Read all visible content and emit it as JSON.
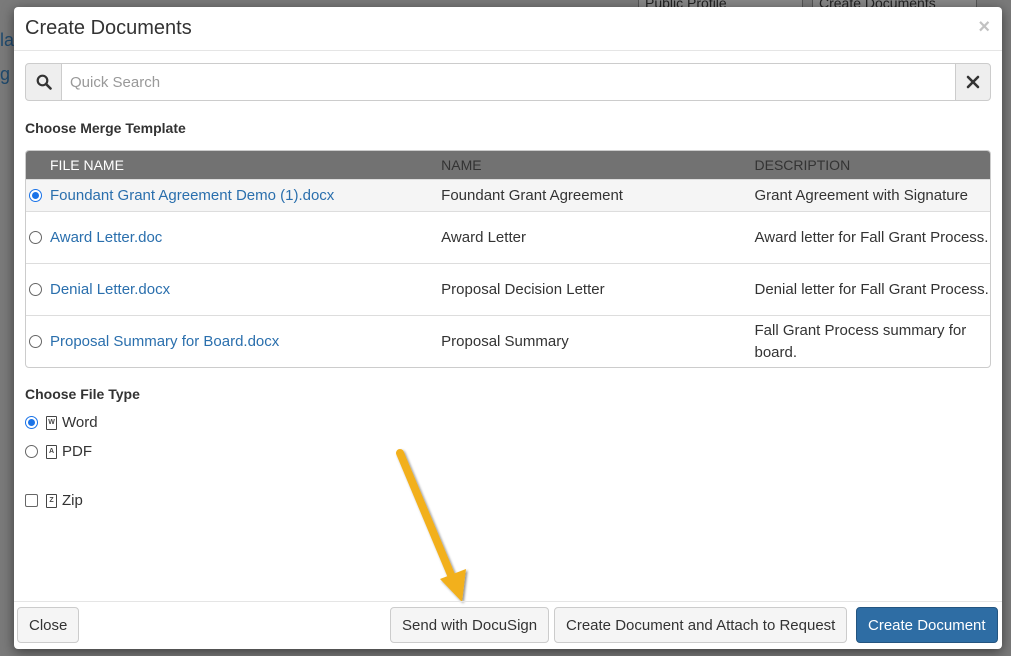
{
  "background": {
    "public_profile_label": "Public Profile",
    "create_documents_label": "Create Documents"
  },
  "modal": {
    "title": "Create Documents",
    "close_symbol": "×"
  },
  "search": {
    "icon": "search-icon",
    "placeholder": "Quick Search",
    "value": "",
    "clear_icon": "clear-icon"
  },
  "merge_template": {
    "label": "Choose Merge Template",
    "columns": [
      "FILE NAME",
      "NAME",
      "DESCRIPTION"
    ],
    "rows": [
      {
        "file_name": "Foundant Grant Agreement Demo (1).docx",
        "name": "Foundant Grant Agreement",
        "description": "Grant Agreement with Signature",
        "selected": true
      },
      {
        "file_name": "Award Letter.doc",
        "name": "Award Letter",
        "description": "Award letter for Fall Grant Process.",
        "selected": false
      },
      {
        "file_name": "Denial Letter.docx",
        "name": "Proposal Decision Letter",
        "description": "Denial letter for Fall Grant Process.",
        "selected": false
      },
      {
        "file_name": "Proposal Summary for Board.docx",
        "name": "Proposal Summary",
        "description": "Fall Grant Process summary for board.",
        "selected": false
      }
    ]
  },
  "file_type": {
    "label": "Choose File Type",
    "options": [
      {
        "label": "Word",
        "icon": "word-file-icon",
        "selected": true
      },
      {
        "label": "PDF",
        "icon": "pdf-file-icon",
        "selected": false
      }
    ],
    "zip": {
      "label": "Zip",
      "icon": "zip-file-icon",
      "checked": false
    }
  },
  "footer": {
    "close_label": "Close",
    "docusign_label": "Send with DocuSign",
    "attach_label": "Create Document and Attach to Request",
    "create_label": "Create Document"
  },
  "colors": {
    "header_bg": "#727272",
    "link": "#2a6fad",
    "primary": "#2e6da4",
    "arrow": "#f2b01e"
  }
}
